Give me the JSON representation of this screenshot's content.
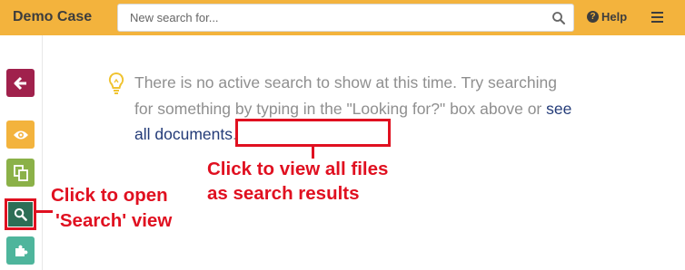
{
  "header": {
    "brand": "Demo Case",
    "search_placeholder": "New search for...",
    "help_label": "Help",
    "help_icon_glyph": "?"
  },
  "sidebar": {
    "items": [
      {
        "name": "back",
        "icon": "arrow-left-icon",
        "color": "#a0214c"
      },
      {
        "name": "view",
        "icon": "eye-icon",
        "color": "#f3b33d"
      },
      {
        "name": "documents",
        "icon": "documents-icon",
        "color": "#8bb148"
      },
      {
        "name": "search",
        "icon": "search-icon",
        "color": "#2d6e56"
      },
      {
        "name": "plugins",
        "icon": "puzzle-icon",
        "color": "#4eb59c"
      }
    ]
  },
  "main": {
    "message": "There is no active search to show at this time. Try searching for something by typing in the \"Looking for?\" box above or ",
    "link_text": "see all documents",
    "message_end": "."
  },
  "annotations": {
    "files_line1": "Click to view all files",
    "files_line2": "as search results",
    "search_line1": "Click to open",
    "search_line2": "'Search' view"
  },
  "colors": {
    "header": "#f3b33d",
    "annotation": "#e01020",
    "link": "#233b78",
    "message_text": "#8f8f8f"
  }
}
